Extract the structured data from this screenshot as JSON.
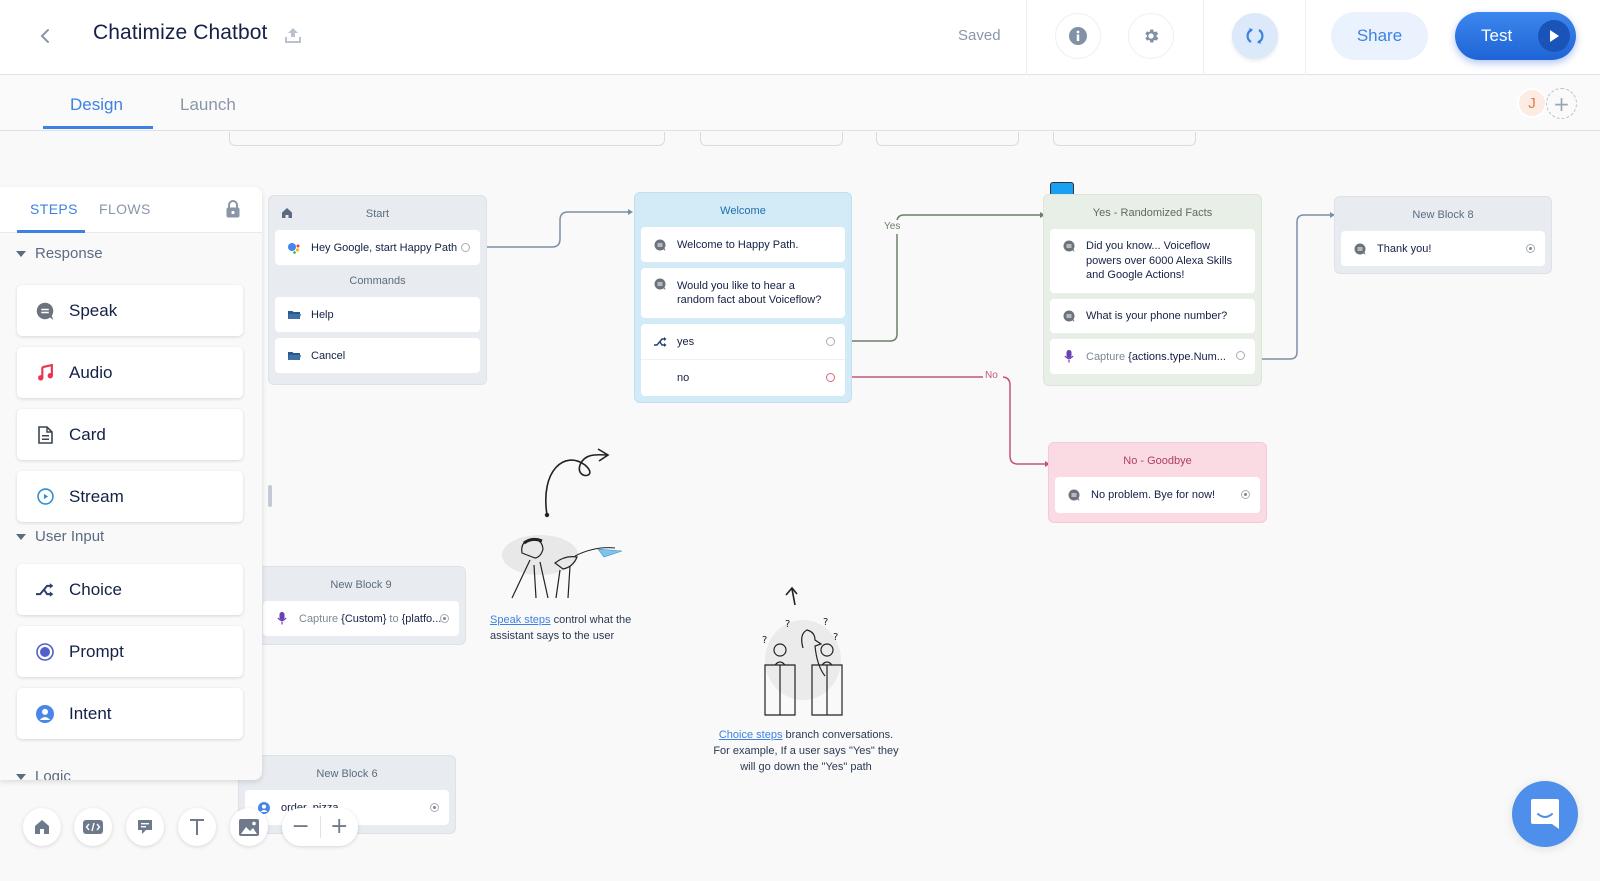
{
  "header": {
    "project_title": "Chatimize Chatbot",
    "save_status": "Saved",
    "share_label": "Share",
    "test_label": "Test",
    "icons": {
      "back": "chevron-left-icon",
      "upload": "upload-icon",
      "info": "info-icon",
      "settings": "gear-icon",
      "sync": "sync-icon",
      "play": "play-icon"
    }
  },
  "tabs": [
    {
      "label": "Design",
      "active": true
    },
    {
      "label": "Launch",
      "active": false
    }
  ],
  "collaborators": {
    "avatar_initial": "J",
    "add_label": "+"
  },
  "sidebar": {
    "tabs": [
      {
        "label": "STEPS",
        "active": true
      },
      {
        "label": "FLOWS",
        "active": false
      }
    ],
    "sections": [
      {
        "title": "Response",
        "items": [
          {
            "label": "Speak",
            "icon": "speak-icon"
          },
          {
            "label": "Audio",
            "icon": "music-note-icon"
          },
          {
            "label": "Card",
            "icon": "card-icon"
          },
          {
            "label": "Stream",
            "icon": "stream-play-icon"
          }
        ]
      },
      {
        "title": "User Input",
        "items": [
          {
            "label": "Choice",
            "icon": "choice-branch-icon"
          },
          {
            "label": "Prompt",
            "icon": "prompt-radio-icon"
          },
          {
            "label": "Intent",
            "icon": "intent-user-icon"
          }
        ]
      },
      {
        "title": "Logic",
        "items": []
      }
    ]
  },
  "canvas": {
    "blocks": {
      "start": {
        "title": "Start",
        "invocation": "Hey Google, start Happy Path",
        "commands_title": "Commands",
        "commands": [
          "Help",
          "Cancel"
        ]
      },
      "welcome": {
        "title": "Welcome",
        "speak_1": "Welcome to Happy Path.",
        "speak_2": "Would you like to hear a random fact about Voiceflow?",
        "choices": [
          "yes",
          "no"
        ]
      },
      "yes_facts": {
        "title": "Yes - Randomized Facts",
        "speak_1": "Did you know... Voiceflow powers over 6000 Alexa Skills and Google Actions!",
        "speak_2": "What is your phone number?",
        "capture_prefix": "Capture",
        "capture_var": "{actions.type.Num..."
      },
      "no_goodbye": {
        "title": "No - Goodbye",
        "speak": "No problem. Bye for now!"
      },
      "block8": {
        "title": "New Block 8",
        "speak": "Thank you!"
      },
      "block9": {
        "title": "New Block 9",
        "capture_prefix": "Capture",
        "capture_var": "{Custom}",
        "capture_to": "to",
        "capture_target": "{platfo..."
      },
      "block6": {
        "title": "New Block 6",
        "intent": "order_pizza"
      }
    },
    "connection_labels": {
      "yes": "Yes",
      "no": "No"
    },
    "tips": {
      "speak": {
        "link": "Speak steps",
        "text_1": " control what the",
        "text_2": "assistant says to the user"
      },
      "choice": {
        "link": "Choice steps",
        "text_1": " branch conversations.",
        "text_2": "For example, If a user says \"Yes\" they",
        "text_3": "will go down the \"Yes\" path"
      }
    }
  },
  "toolbar": {
    "tools": [
      "home-icon",
      "code-icon",
      "comment-icon",
      "text-icon",
      "image-icon"
    ],
    "zoom_out": "−",
    "zoom_in": "+"
  },
  "colors": {
    "accent": "#3d82e2",
    "welcome_block": "#d3eaf7",
    "yes_block": "#e8efe6",
    "no_block": "#fbdbe3",
    "default_block": "#e8ecf1",
    "yes_line": "#6d7f6a",
    "no_line": "#c2567a",
    "default_line": "#7a90a8"
  }
}
